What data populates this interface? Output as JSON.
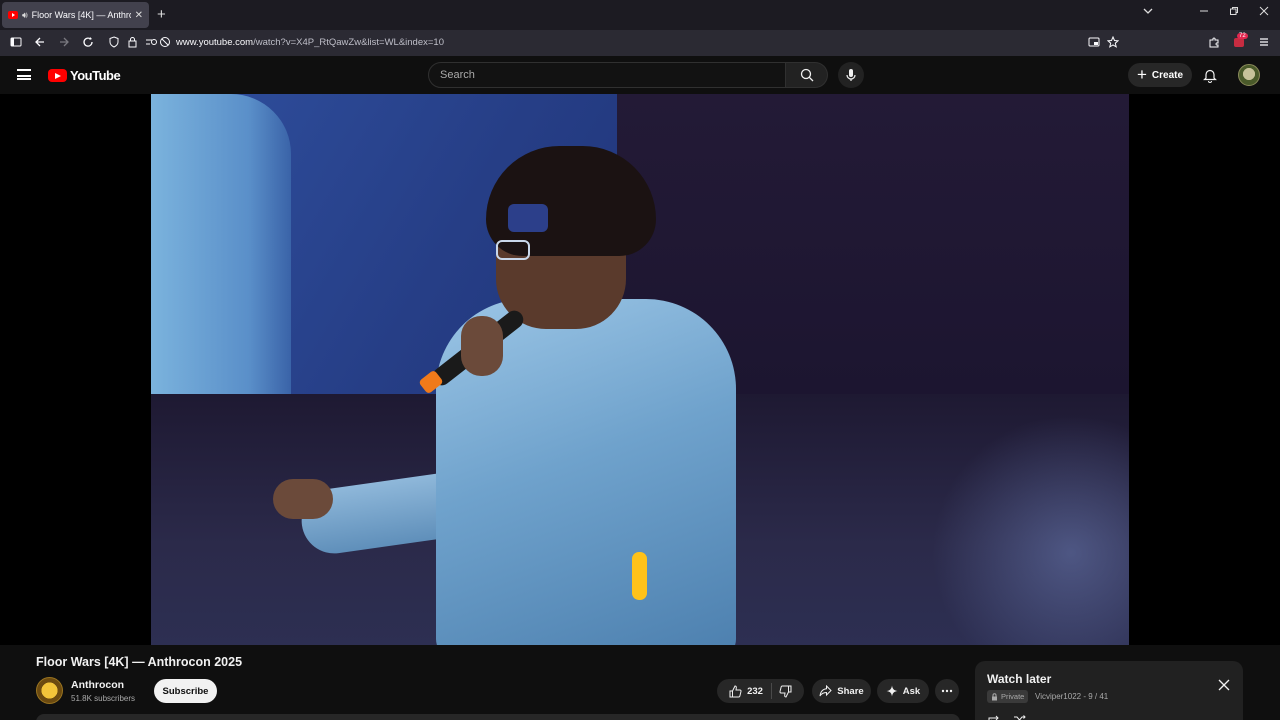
{
  "browser": {
    "tab_title": "Floor Wars [4K] — Anthroc",
    "url_host": "www.youtube.com",
    "url_path": "/watch?v=X4P_RtQawZw&list=WL&index=10",
    "extension_badge": "72"
  },
  "youtube": {
    "logo_text": "YouTube",
    "search_placeholder": "Search",
    "create_label": "Create"
  },
  "video": {
    "title": "Floor Wars [4K] — Anthrocon 2025",
    "channel_name": "Anthrocon",
    "channel_subscribers": "51.8K subscribers",
    "subscribe_label": "Subscribe",
    "like_count": "232",
    "share_label": "Share",
    "ask_label": "Ask"
  },
  "playlist": {
    "title": "Watch later",
    "privacy": "Private",
    "owner_progress": "Vicviper1022 - 9 / 41"
  },
  "colors": {
    "background": "#0f0f0f",
    "brand_red": "#ff0000",
    "pill_bg": "#272727",
    "panel_bg": "#212121"
  }
}
